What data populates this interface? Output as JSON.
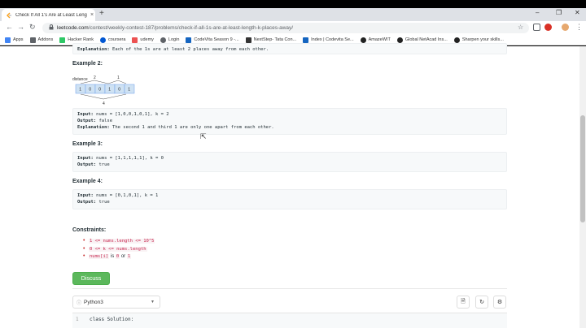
{
  "browser": {
    "tab_title": "Check If All 1's Are at Least Leng",
    "tab_close": "×",
    "new_tab": "+",
    "url_host": "leetcode.com",
    "url_path": "/contest/weekly-contest-187/problems/check-if-all-1s-are-at-least-length-k-places-away/",
    "window_min": "–",
    "window_max": "❐",
    "window_close": "✕",
    "back": "←",
    "forward": "→",
    "reload": "↻",
    "star": "☆"
  },
  "bookmarks": [
    {
      "label": "Apps",
      "color": "#4285f4"
    },
    {
      "label": "Addons",
      "color": "#5f6368"
    },
    {
      "label": "Hacker Rank",
      "color": "#2ec866"
    },
    {
      "label": "coursera",
      "color": "#0056d2"
    },
    {
      "label": "udemy",
      "color": "#ec5252"
    },
    {
      "label": "Login",
      "color": "#5f6368"
    },
    {
      "label": "CodeVita Season 9 -...",
      "color": "#1565c0"
    },
    {
      "label": "NextStep- Tata Con...",
      "color": "#333333"
    },
    {
      "label": "Index | Codevita Se...",
      "color": "#1565c0"
    },
    {
      "label": "AmazeWIT",
      "color": "#222222"
    },
    {
      "label": "Global NetAcad Ins...",
      "color": "#222222"
    },
    {
      "label": "Sharpen your skills...",
      "color": "#222222"
    }
  ],
  "problem": {
    "top_explanation_label": "Explanation:",
    "top_explanation_text": " Each of the 1s are at least 2 places away from each other.",
    "example2_heading": "Example 2:",
    "diagram": {
      "label": "distance",
      "cells": [
        "1",
        "0",
        "0",
        "1",
        "0",
        "1"
      ],
      "top_left": "2",
      "top_right": "1",
      "bottom": "4"
    },
    "example2": {
      "input_label": "Input:",
      "input_value": " nums = [1,0,0,1,0,1], k = 2",
      "output_label": "Output:",
      "output_value": " false",
      "explanation_label": "Explanation:",
      "explanation_value": " The second 1 and third 1 are only one apart from each other."
    },
    "example3_heading": "Example 3:",
    "example3": {
      "input_label": "Input:",
      "input_value": " nums = [1,1,1,1,1], k = 0",
      "output_label": "Output:",
      "output_value": " true"
    },
    "example4_heading": "Example 4:",
    "example4": {
      "input_label": "Input:",
      "input_value": " nums = [0,1,0,1], k = 1",
      "output_label": "Output:",
      "output_value": " true"
    },
    "constraints_heading": "Constraints:",
    "constraints": [
      {
        "code": "1 <= nums.length <= 10^5",
        "rest": ""
      },
      {
        "code": "0 <= k <= nums.length",
        "rest": ""
      },
      {
        "code": "nums[i]",
        "rest": " is ",
        "code2": "0",
        "rest2": " or ",
        "code3": "1"
      }
    ],
    "discuss_label": "Discuss"
  },
  "editor": {
    "language": "Python3",
    "line_no": "1",
    "first_line": "class Solution:"
  },
  "colors": {
    "discuss_green": "#5cb85c",
    "code_red": "#c7254e",
    "diagram_cell": "#cfe2f3"
  }
}
